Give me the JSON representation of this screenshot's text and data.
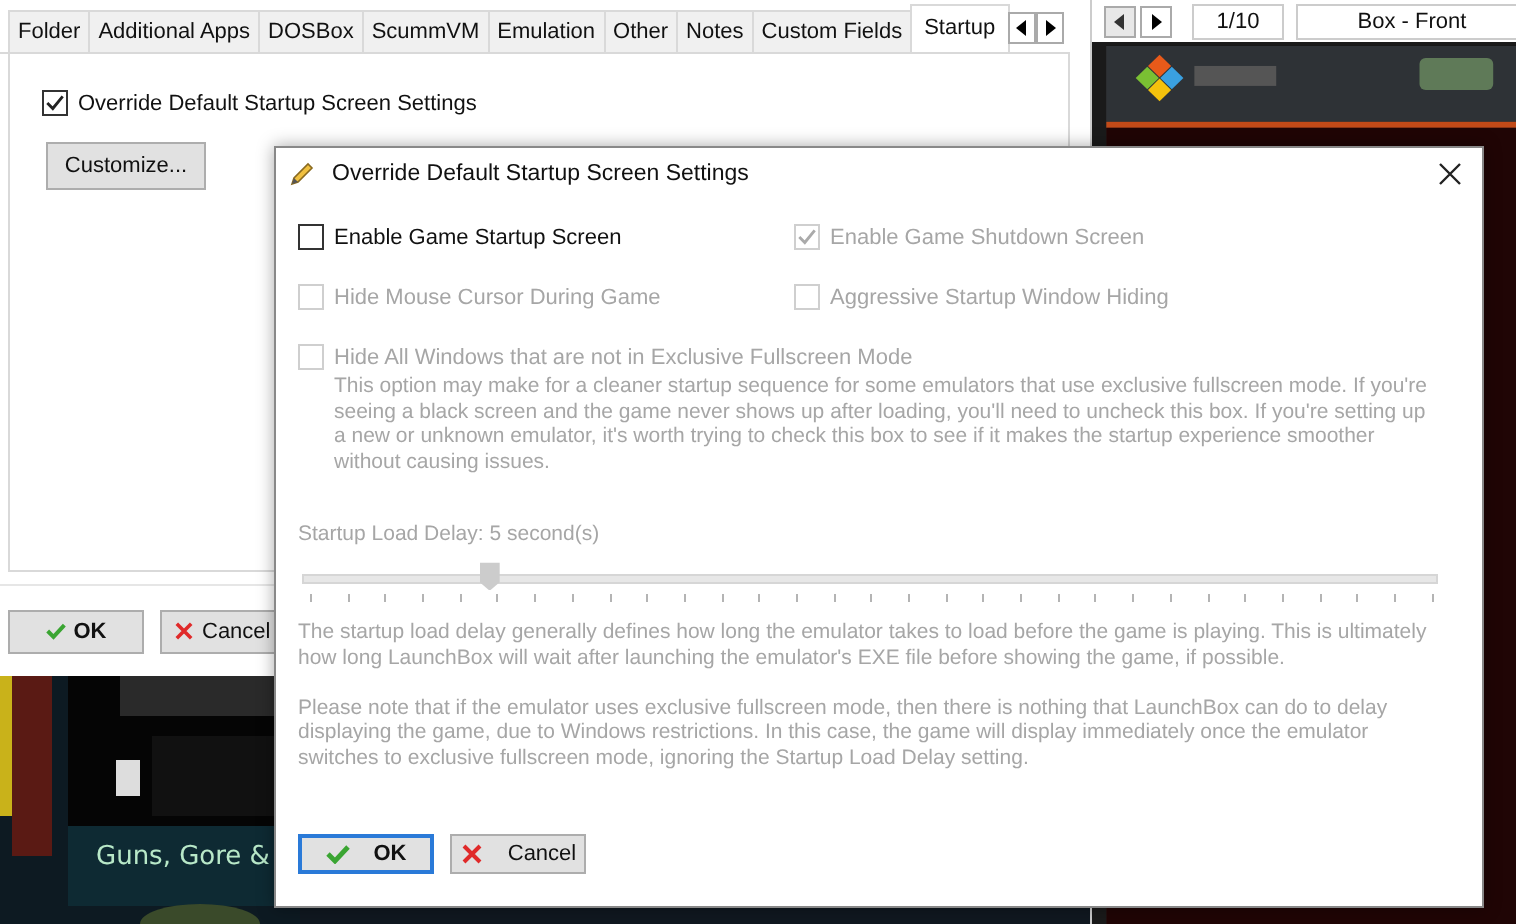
{
  "tabs": [
    {
      "label": "Folder",
      "selected": false
    },
    {
      "label": "Additional Apps",
      "selected": false
    },
    {
      "label": "DOSBox",
      "selected": false
    },
    {
      "label": "ScummVM",
      "selected": false
    },
    {
      "label": "Emulation",
      "selected": false
    },
    {
      "label": "Other",
      "selected": false
    },
    {
      "label": "Notes",
      "selected": false
    },
    {
      "label": "Custom Fields",
      "selected": false
    },
    {
      "label": "Startup",
      "selected": true
    }
  ],
  "override_checkbox": {
    "label": "Override Default Startup Screen Settings",
    "checked": true
  },
  "customize_button": "Customize...",
  "footer_buttons": [
    {
      "label": "OK",
      "kind": "ok"
    },
    {
      "label": "Cancel",
      "kind": "cancel"
    }
  ],
  "game_title": "Guns, Gore &",
  "pager": {
    "position": "1/10",
    "image_type": "Box - Front"
  },
  "dialog": {
    "title": "Override Default Startup Screen Settings",
    "options": [
      {
        "label": "Enable Game Startup Screen",
        "checked": false,
        "disabled": false
      },
      {
        "label": "Enable Game Shutdown Screen",
        "checked": true,
        "disabled": true
      },
      {
        "label": "Hide Mouse Cursor During Game",
        "checked": false,
        "disabled": true
      },
      {
        "label": "Aggressive Startup Window Hiding",
        "checked": false,
        "disabled": true
      },
      {
        "label": "Hide All Windows that are not in Exclusive Fullscreen Mode",
        "checked": false,
        "disabled": true
      }
    ],
    "note": "This option may make for a cleaner startup sequence for some emulators that use exclusive fullscreen mode. If you're seeing a black screen and the game never shows up after loading, you'll need to uncheck this box. If you're setting up a new or unknown emulator, it's worth trying to check this box to see if it makes the startup experience smoother without causing issues.",
    "delay_label": "Startup Load Delay: 5 second(s)",
    "delay_slider": {
      "level": 0.167,
      "disabled": true
    },
    "paragraphs": [
      "The startup load delay generally defines how long the emulator takes to load before the game is playing. This is ultimately how long LaunchBox will wait after launching the emulator's EXE file before showing the game, if possible.",
      "Please note that if the emulator uses exclusive fullscreen mode, then there is nothing that LaunchBox can do to delay displaying the game, due to Windows restrictions. In this case, the game will display immediately once the emulator switches to exclusive fullscreen mode, ignoring the Startup Load Delay setting."
    ],
    "buttons": [
      {
        "label": "OK",
        "kind": "ok",
        "selected": true
      },
      {
        "label": "Cancel",
        "kind": "cancel",
        "selected": false
      }
    ]
  }
}
